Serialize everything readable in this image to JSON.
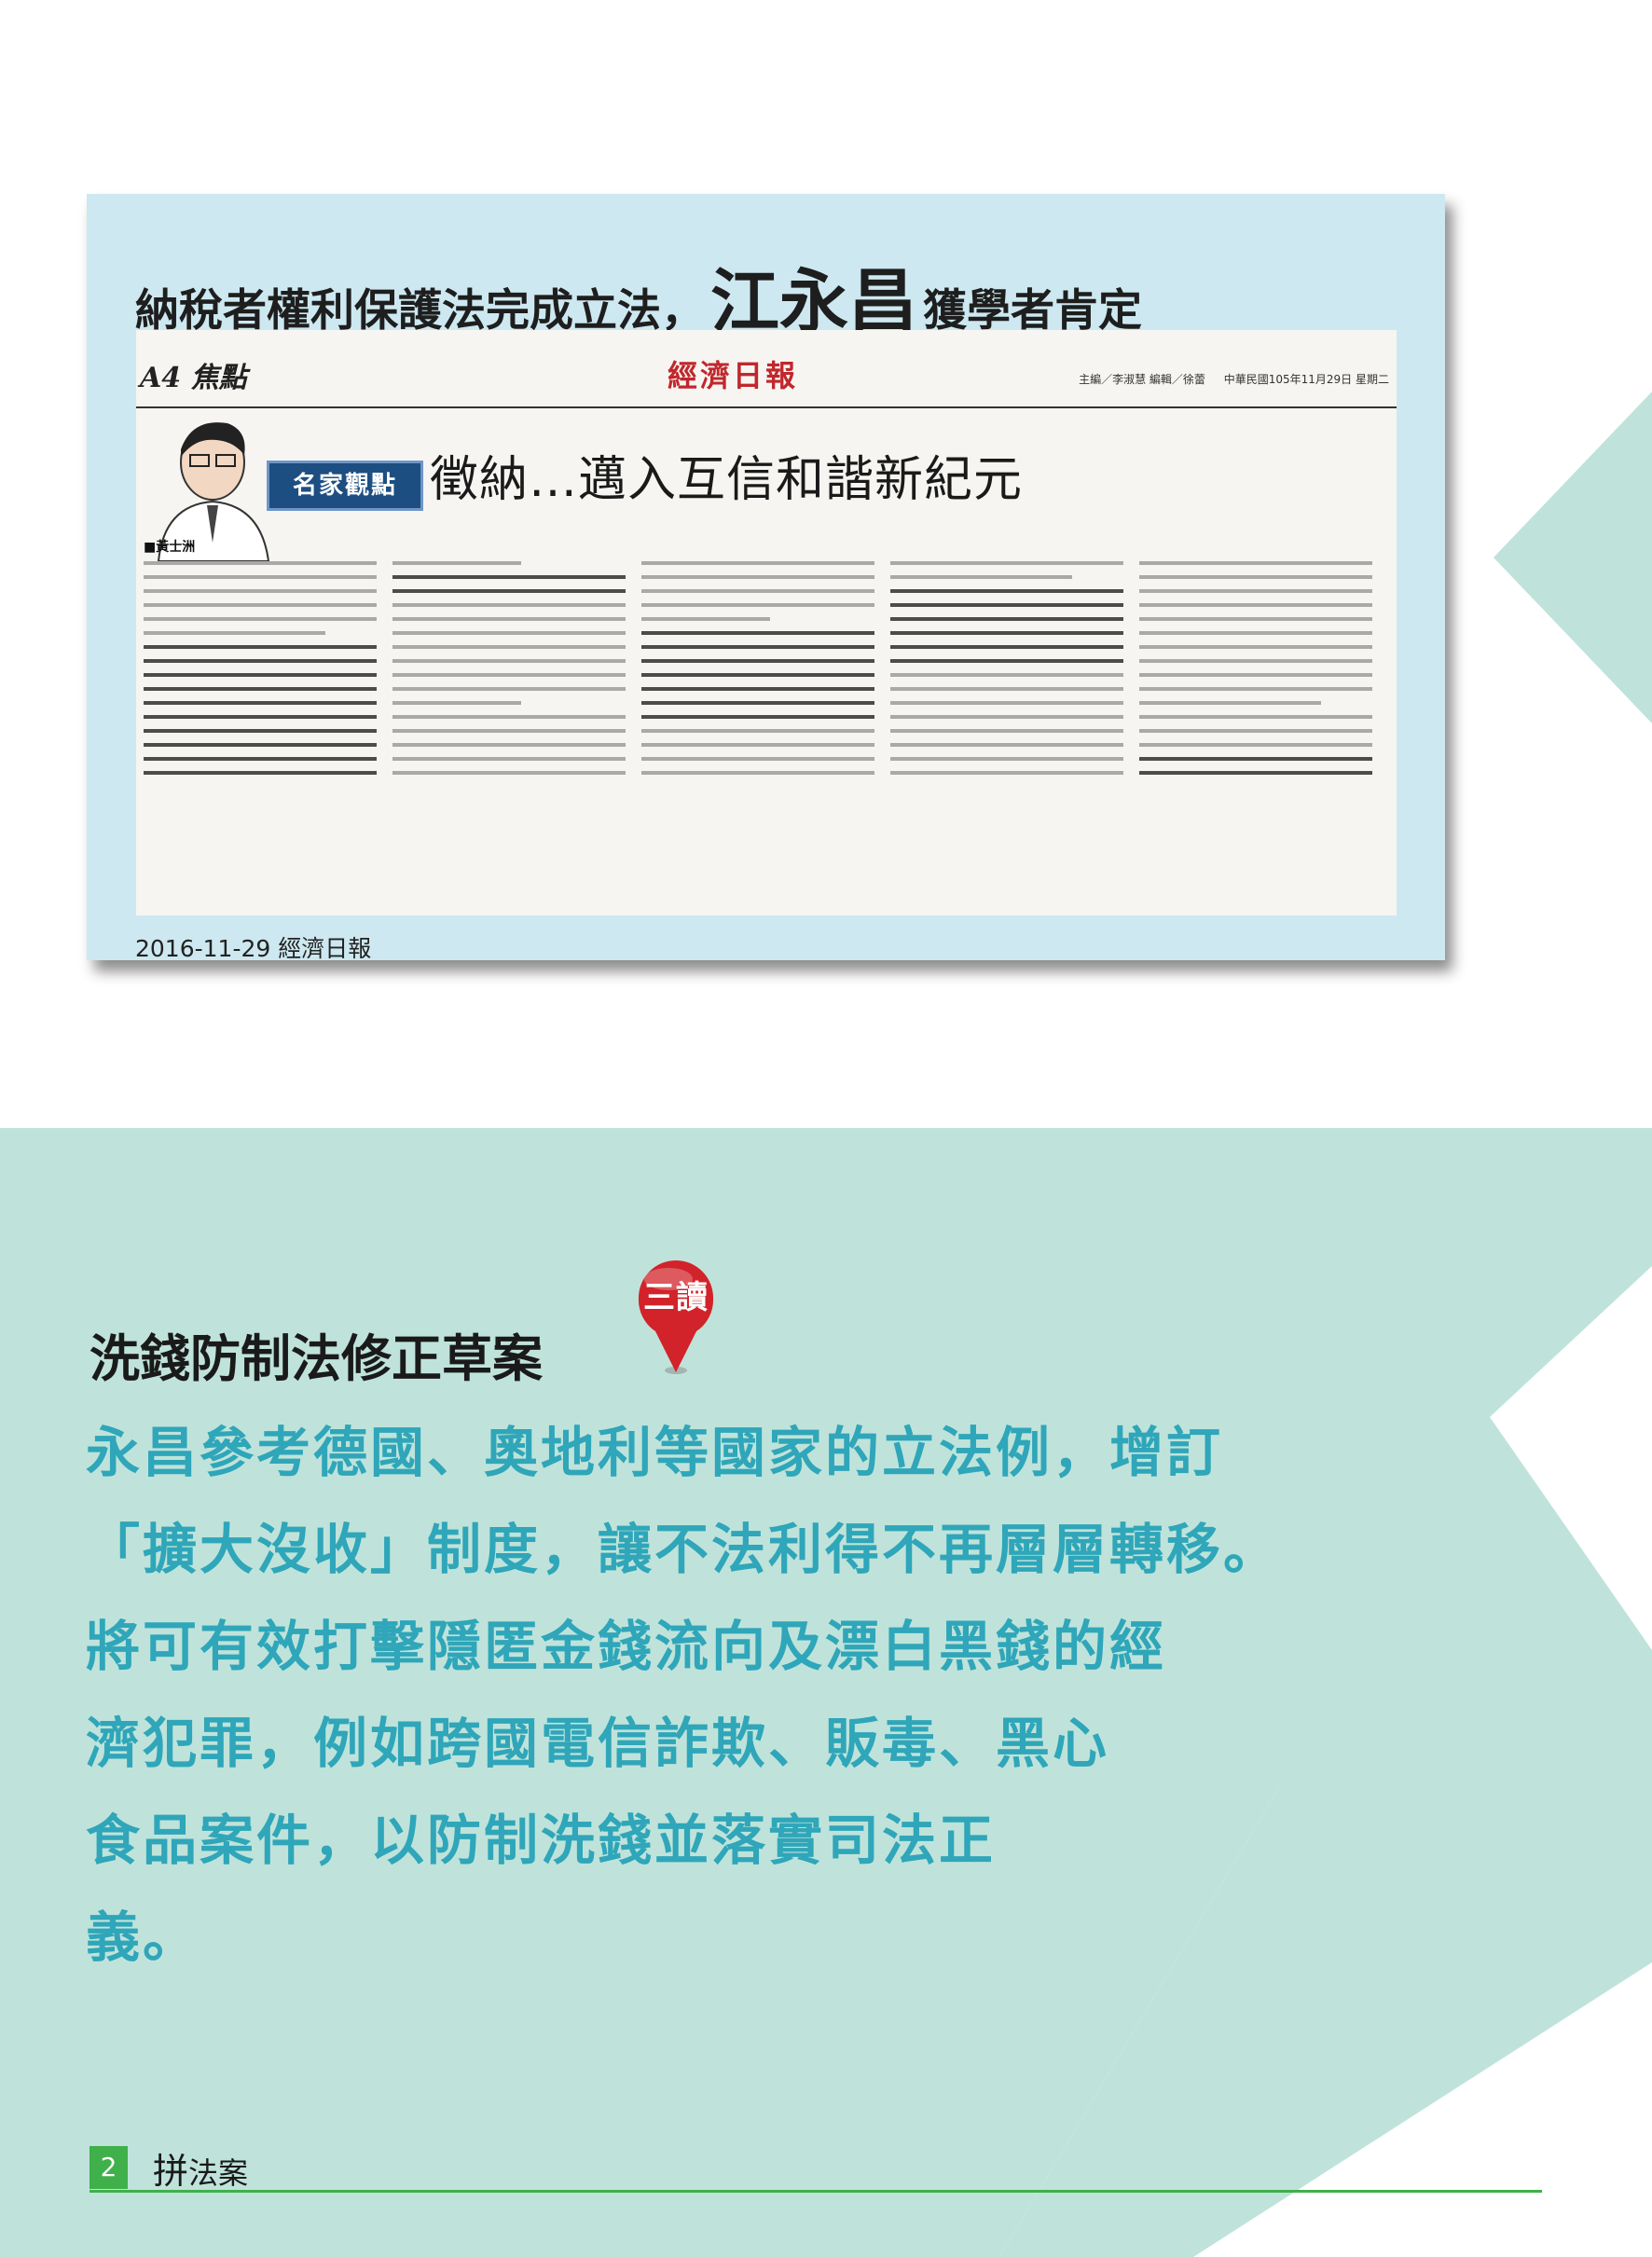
{
  "colors": {
    "band": "#bfe3da",
    "card": "#cde8f0",
    "accent_text": "#2fa6b9",
    "green": "#3fb04a",
    "badge": "#d2232a",
    "column_band": "#1d4e82"
  },
  "clipping": {
    "headline_a": "納稅者權利保護法完成立法，",
    "headline_b": "江永昌",
    "headline_c": "獲學者肯定",
    "date_source": "2016-11-29 經濟日報",
    "newspaper": {
      "section": "A4 焦點",
      "name": "經濟日報",
      "meta_editor": "主編／李淑慧 編輯／徐蕾",
      "meta_date": "中華民國105年11月29日 星期二",
      "column_label": "名家觀點",
      "title": "徵納…邁入互信和諧新紀元",
      "author": "■黃士洲",
      "portrait_icon": "author-portrait"
    }
  },
  "reading": {
    "title": "洗錢防制法修正草案",
    "badge": "三讀",
    "badge_icon": "map-pin-icon",
    "lines": [
      "永昌參考德國、奧地利等國家的立法例，增訂",
      "「擴大沒收」制度，讓不法利得不再層層轉移。",
      "將可有效打擊隱匿金錢流向及漂白黑錢的經",
      "濟犯罪，例如跨國電信詐欺、販毒、黑心",
      "食品案件，以防制洗錢並落實司法正",
      "義。"
    ]
  },
  "footer": {
    "page_number": "2",
    "logo": "拼",
    "publication": "法案"
  }
}
